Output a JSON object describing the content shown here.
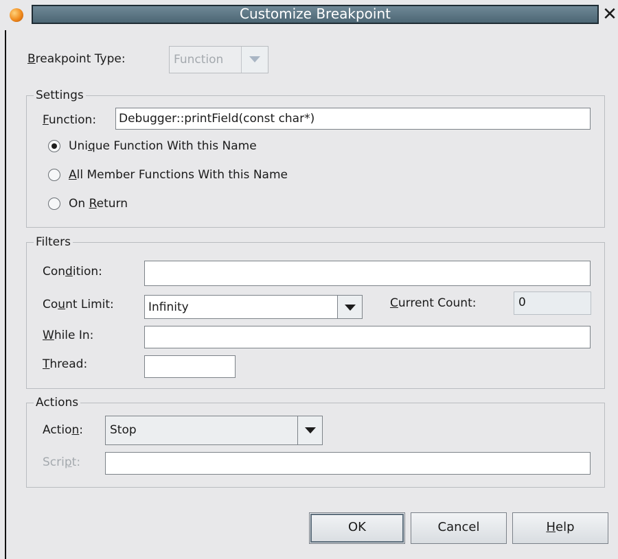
{
  "window": {
    "title": "Customize Breakpoint",
    "close_glyph": "✕"
  },
  "breakpoint_type": {
    "label": "Breakpoint Type:",
    "value": "Function"
  },
  "settings": {
    "title": "Settings",
    "function_label": "Function:",
    "function_value": "Debugger::printField(const char*)",
    "radios": [
      {
        "label": "Unique Function With this Name",
        "checked": true
      },
      {
        "label": "All Member Functions With this Name",
        "checked": false
      },
      {
        "label": "On Return",
        "checked": false
      }
    ]
  },
  "filters": {
    "title": "Filters",
    "condition_label": "Condition:",
    "condition_value": "",
    "count_limit_label": "Count Limit:",
    "count_limit_value": "Infinity",
    "current_count_label": "Current Count:",
    "current_count_value": "0",
    "while_in_label": "While In:",
    "while_in_value": "",
    "thread_label": "Thread:",
    "thread_value": ""
  },
  "actions": {
    "title": "Actions",
    "action_label": "Action:",
    "action_value": "Stop",
    "script_label": "Script:",
    "script_value": ""
  },
  "buttons": {
    "ok": "OK",
    "cancel": "Cancel",
    "help": "Help"
  },
  "colors": {
    "titlebar": "#5d7685",
    "dialog_bg": "#e8e8ea",
    "disabled_text": "#a4a9ae"
  }
}
